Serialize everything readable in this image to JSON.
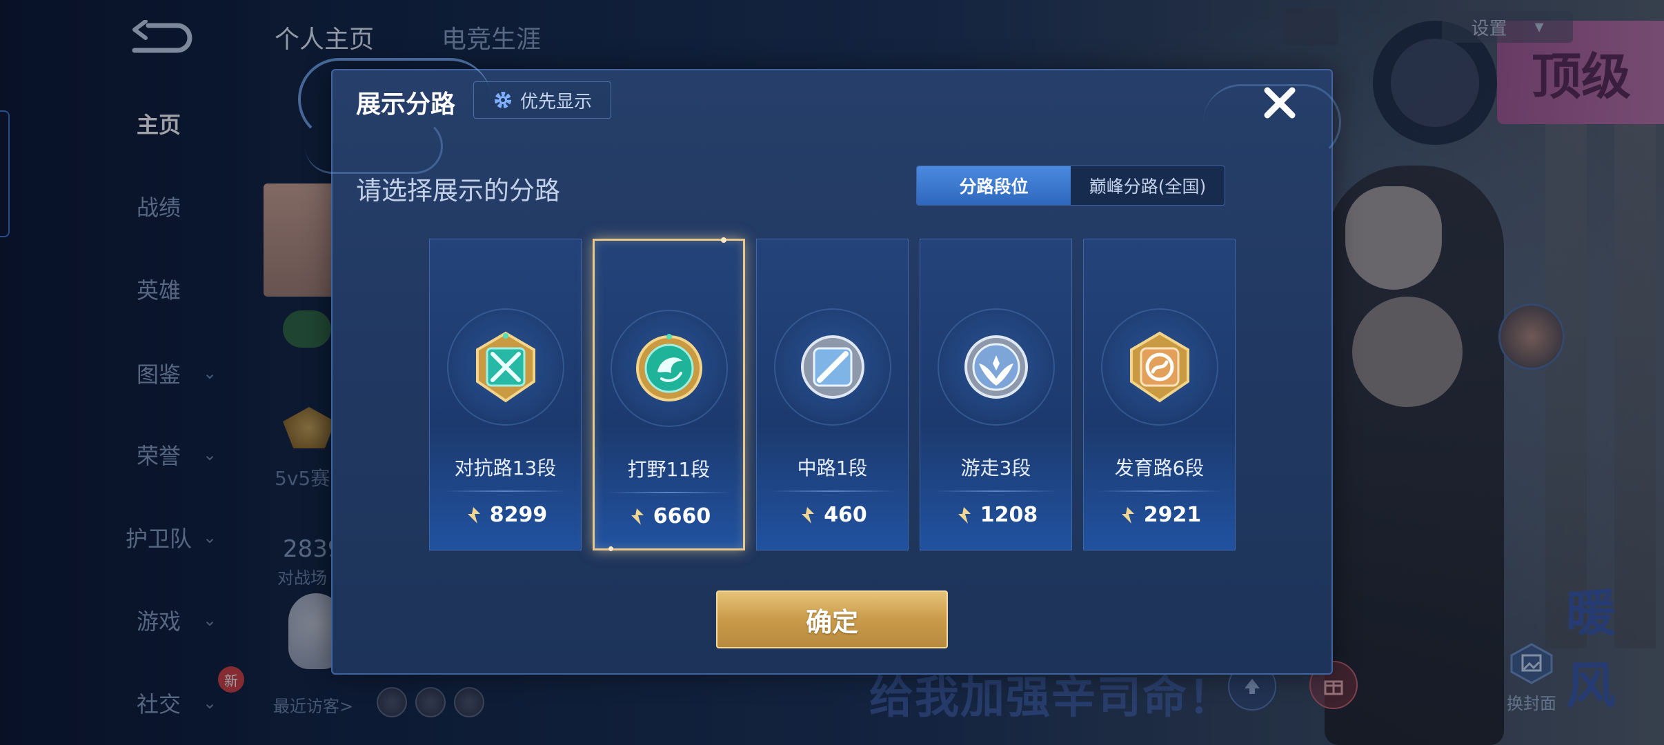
{
  "top_tabs": [
    "个人主页",
    "电竞生涯"
  ],
  "nav": {
    "items": [
      {
        "label": "主页",
        "has_chevron": false
      },
      {
        "label": "战绩",
        "has_chevron": false
      },
      {
        "label": "英雄",
        "has_chevron": false
      },
      {
        "label": "图鉴",
        "has_chevron": true
      },
      {
        "label": "荣誉",
        "has_chevron": true
      },
      {
        "label": "护卫队",
        "has_chevron": true
      },
      {
        "label": "游戏",
        "has_chevron": true
      },
      {
        "label": "社交",
        "has_chevron": true
      }
    ],
    "new_badge": "新"
  },
  "profile_partial": {
    "mode_text": "5v5赛",
    "count_text": "2839",
    "arena_text": "对战场",
    "recent_visitors": "最近访客>"
  },
  "right": {
    "settings_label": "设置",
    "cover_label": "换封面",
    "bg_text_1": "顶级",
    "bg_text_2": "暖风",
    "bg_bottom": "给我加强辛司命！"
  },
  "dialog": {
    "title": "展示分路",
    "priority_label": "优先显示",
    "subtitle": "请选择展示的分路",
    "toggle": [
      {
        "label": "分路段位",
        "active": true
      },
      {
        "label": "巅峰分路(全国)",
        "active": false
      }
    ],
    "cards": [
      {
        "label": "对抗路13段",
        "score": "8299",
        "icon": "clash-lane-emblem",
        "selected": false,
        "color": "#27b9a6"
      },
      {
        "label": "打野11段",
        "score": "6660",
        "icon": "jungle-emblem",
        "selected": true,
        "color": "#1fb39a"
      },
      {
        "label": "中路1段",
        "score": "460",
        "icon": "mid-lane-emblem",
        "selected": false,
        "color": "#7eb4e6"
      },
      {
        "label": "游走3段",
        "score": "1208",
        "icon": "roam-emblem",
        "selected": false,
        "color": "#7ea5d8"
      },
      {
        "label": "发育路6段",
        "score": "2921",
        "icon": "farm-lane-emblem",
        "selected": false,
        "color": "#e2a05a"
      }
    ],
    "confirm_label": "确定"
  }
}
